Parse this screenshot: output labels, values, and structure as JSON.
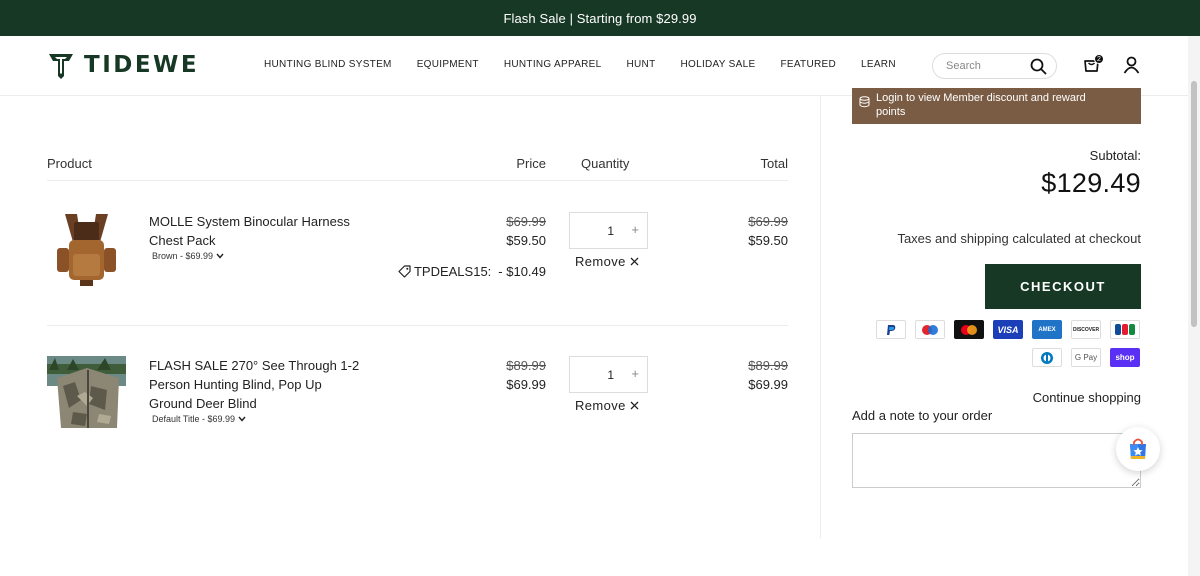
{
  "announcement": "Flash Sale | Starting from $29.99",
  "header": {
    "logo_text": "TIDEWE",
    "nav": [
      "HUNTING BLIND SYSTEM",
      "EQUIPMENT",
      "HUNTING APPAREL",
      "HUNT",
      "HOLIDAY SALE",
      "FEATURED",
      "LEARN"
    ],
    "search_placeholder": "Search",
    "cart_count": "2"
  },
  "cart": {
    "columns": {
      "product": "Product",
      "price": "Price",
      "quantity": "Quantity",
      "total": "Total"
    },
    "items": [
      {
        "title_line1": "MOLLE System Binocular Harness",
        "title_line2": "Chest Pack",
        "variant": "Brown - $69.99",
        "price_original": "$69.99",
        "price_sale": "$59.50",
        "discount_code": "TPDEALS15:",
        "discount_amount": "- $10.49",
        "quantity": "1",
        "remove_label": "Remove",
        "total_original": "$69.99",
        "total_sale": "$59.50"
      },
      {
        "title_line1": "FLASH SALE 270° See Through 1-2",
        "title_line2": "Person Hunting Blind, Pop Up",
        "title_line3": "Ground Deer Blind",
        "variant": "Default Title - $69.99",
        "price_original": "$89.99",
        "price_sale": "$69.99",
        "quantity": "1",
        "remove_label": "Remove",
        "total_original": "$89.99",
        "total_sale": "$69.99"
      }
    ]
  },
  "summary": {
    "member_text_line1": "Login to view Member discount and reward",
    "member_text_line2": "points",
    "subtotal_label": "Subtotal:",
    "subtotal_value": "$129.49",
    "taxes_note": "Taxes and shipping calculated at checkout",
    "checkout_label": "CHECKOUT",
    "payment_methods": [
      "PayPal",
      "Maestro",
      "Mastercard",
      "VISA",
      "AMEX",
      "DISCOVER",
      "JCB",
      "Diners",
      "G Pay",
      "shop"
    ],
    "continue_label": "Continue shopping",
    "note_label": "Add a note to your order"
  },
  "colors": {
    "brand_green": "#183826",
    "member_brown": "#7a5c44"
  }
}
